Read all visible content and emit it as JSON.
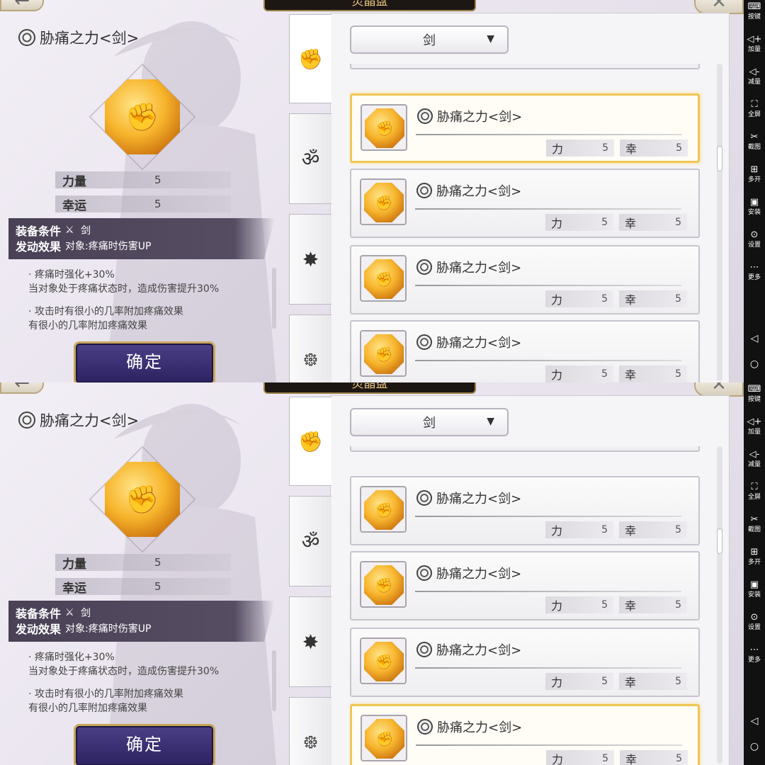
{
  "window": {
    "title": "灵晶盘"
  },
  "detail": {
    "name": "胁痛之力<剑>",
    "stats": [
      {
        "label": "力量",
        "value": "5"
      },
      {
        "label": "幸运",
        "value": "5"
      }
    ],
    "condition_label": "装备条件",
    "condition_value": "剑",
    "effect_label": "发动效果",
    "effect_value": "对象:疼痛时伤害UP",
    "desc1_title": "· 疼痛时强化+30%",
    "desc1_body": "当对象处于疼痛状态时，造成伤害提升30%",
    "desc2_title": "· 攻击时有很小的几率附加疼痛效果",
    "desc2_body": "有很小的几率附加疼痛效果",
    "confirm_label": "确定"
  },
  "filter": {
    "selected": "剑",
    "caret": "▼"
  },
  "tabs": [
    {
      "icon": "fist-icon",
      "glyph": "✊"
    },
    {
      "icon": "swirl-star-icon",
      "glyph": "ॐ"
    },
    {
      "icon": "star-burst-icon",
      "glyph": "✸"
    },
    {
      "icon": "spiral-icon",
      "glyph": "᪥"
    }
  ],
  "card": {
    "name": "胁痛之力<剑>",
    "stat1_label": "力",
    "stat1_value": "5",
    "stat2_label": "幸",
    "stat2_value": "5"
  },
  "sidebar": {
    "items": [
      {
        "icon": "keyboard-icon",
        "glyph": "⌨",
        "label": "按键"
      },
      {
        "icon": "volume-up-icon",
        "glyph": "◁+",
        "label": "加量"
      },
      {
        "icon": "volume-down-icon",
        "glyph": "◁-",
        "label": "减量"
      },
      {
        "icon": "fullscreen-icon",
        "glyph": "⛶",
        "label": "全屏"
      },
      {
        "icon": "scissors-icon",
        "glyph": "✂",
        "label": "截图"
      },
      {
        "icon": "multi-open-icon",
        "glyph": "⊞",
        "label": "多开"
      },
      {
        "icon": "apk-icon",
        "glyph": "▣",
        "label": "安装"
      },
      {
        "icon": "settings-icon",
        "glyph": "⊙",
        "label": "设置"
      },
      {
        "icon": "more-icon",
        "glyph": "⋯",
        "label": "更多"
      }
    ],
    "nav": [
      {
        "icon": "back-triangle-icon",
        "glyph": "◁"
      },
      {
        "icon": "home-circle-icon",
        "glyph": "○"
      }
    ]
  },
  "colors": {
    "accent_gold": "#f0c654",
    "panel_dark": "#4a4156",
    "button_blue": "#2c2260"
  }
}
